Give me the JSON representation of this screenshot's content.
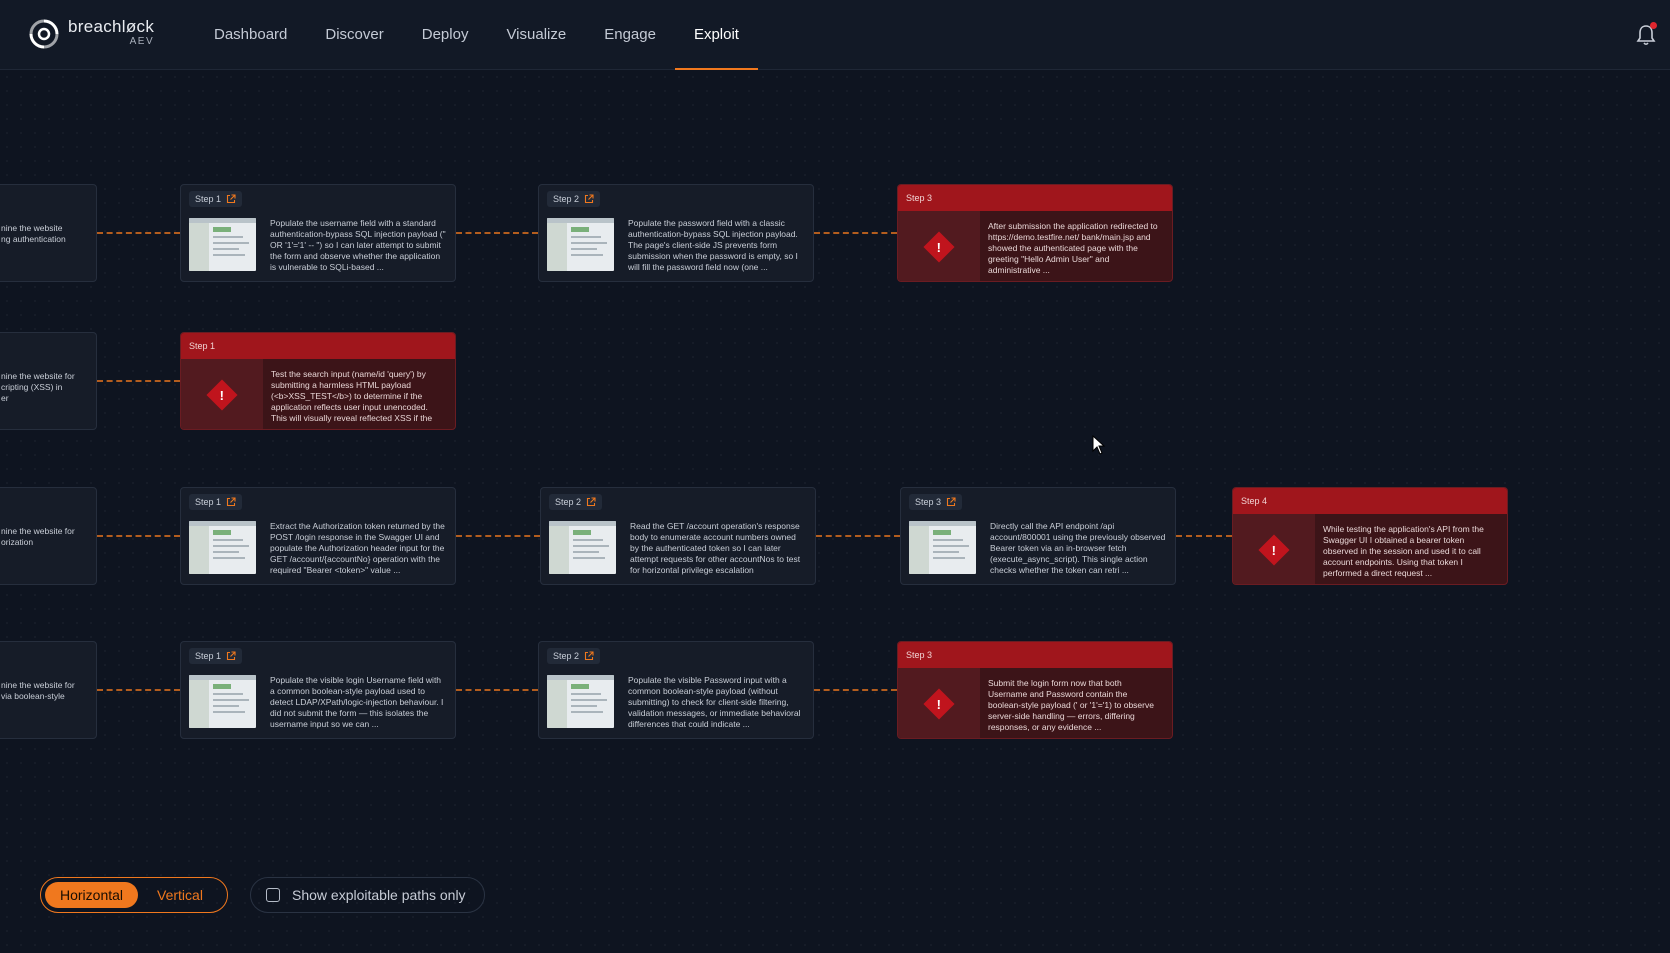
{
  "header": {
    "brand": "breachløck",
    "product": "AEV",
    "nav": [
      "Dashboard",
      "Discover",
      "Deploy",
      "Visualize",
      "Engage",
      "Exploit"
    ],
    "active_nav": "Exploit"
  },
  "rows": [
    {
      "stub_text": [
        "nine the website",
        "ng authentication"
      ],
      "steps": [
        {
          "label": "Step 1",
          "type": "normal",
          "text": "Populate the username field with a standard authentication-bypass SQL injection payload (\" OR '1'='1' -- \") so I can later attempt to submit the form and observe whether the application is vulnerable to SQLi-based ..."
        },
        {
          "label": "Step 2",
          "type": "normal",
          "text": "Populate the password field with a classic authentication-bypass SQL injection payload. The page's client-side JS prevents form submission when the password is empty, so I will fill the password field now (one ..."
        },
        {
          "label": "Step 3",
          "type": "exploit",
          "text": "After submission the application redirected to https://demo.testfire.net/ bank/main.jsp and showed the authenticated page with the greeting \"Hello Admin User\" and administrative ..."
        }
      ]
    },
    {
      "stub_text": [
        "nine the website for",
        "cripting (XSS) in",
        "er"
      ],
      "steps": [
        {
          "label": "Step 1",
          "type": "exploit",
          "text": "Test the search input (name/id 'query') by submitting a harmless HTML payload (<b>XSS_TEST</b>) to determine if the application reflects user input unencoded. This will visually reveal reflected XSS if the"
        }
      ]
    },
    {
      "stub_text": [
        "nine the website for",
        "orization"
      ],
      "steps": [
        {
          "label": "Step 1",
          "type": "normal",
          "text": "Extract the Authorization token returned by the POST /login response in the Swagger UI and populate the Authorization header input for the GET /account/{accountNo} operation with the required \"Bearer <token>\" value ..."
        },
        {
          "label": "Step 2",
          "type": "normal",
          "text": "Read the GET /account operation's response body to enumerate account numbers owned by the authenticated token so I can later attempt requests for other accountNos to test for horizontal privilege escalation"
        },
        {
          "label": "Step 3",
          "type": "normal",
          "text": "Directly call the API endpoint /api account/800001 using the previously observed Bearer token via an in-browser fetch (execute_async_script). This single action checks whether the token can retri ..."
        },
        {
          "label": "Step 4",
          "type": "exploit",
          "text": "While testing the application's API from the Swagger UI I obtained a bearer token observed in the session and used it to call account endpoints. Using that token I performed a direct request ..."
        }
      ]
    },
    {
      "stub_text": [
        "nine the website for",
        "via boolean-style"
      ],
      "steps": [
        {
          "label": "Step 1",
          "type": "normal",
          "text": "Populate the visible login Username field with a common boolean-style payload used to detect LDAP/XPath/logic-injection behaviour. I did not submit the form — this isolates the username input so we can ..."
        },
        {
          "label": "Step 2",
          "type": "normal",
          "text": "Populate the visible Password input with a common boolean-style payload (without submitting) to check for client-side filtering, validation messages, or immediate behavioral differences that could indicate ..."
        },
        {
          "label": "Step 3",
          "type": "exploit",
          "text": "Submit the login form now that both Username and Password contain the boolean-style payload (' or '1'='1) to observe server-side handling — errors, differing responses, or any evidence ..."
        }
      ]
    }
  ],
  "controls": {
    "layout_options": [
      "Horizontal",
      "Vertical"
    ],
    "layout_selected": "Horizontal",
    "filter_label": "Show exploitable paths only",
    "filter_checked": false
  },
  "colors": {
    "accent": "#f0781e",
    "exploit_red": "#a0161c",
    "background": "#0e1420"
  },
  "icons": [
    "bell-icon",
    "external-link-icon",
    "warning-diamond-icon",
    "cursor-icon"
  ]
}
